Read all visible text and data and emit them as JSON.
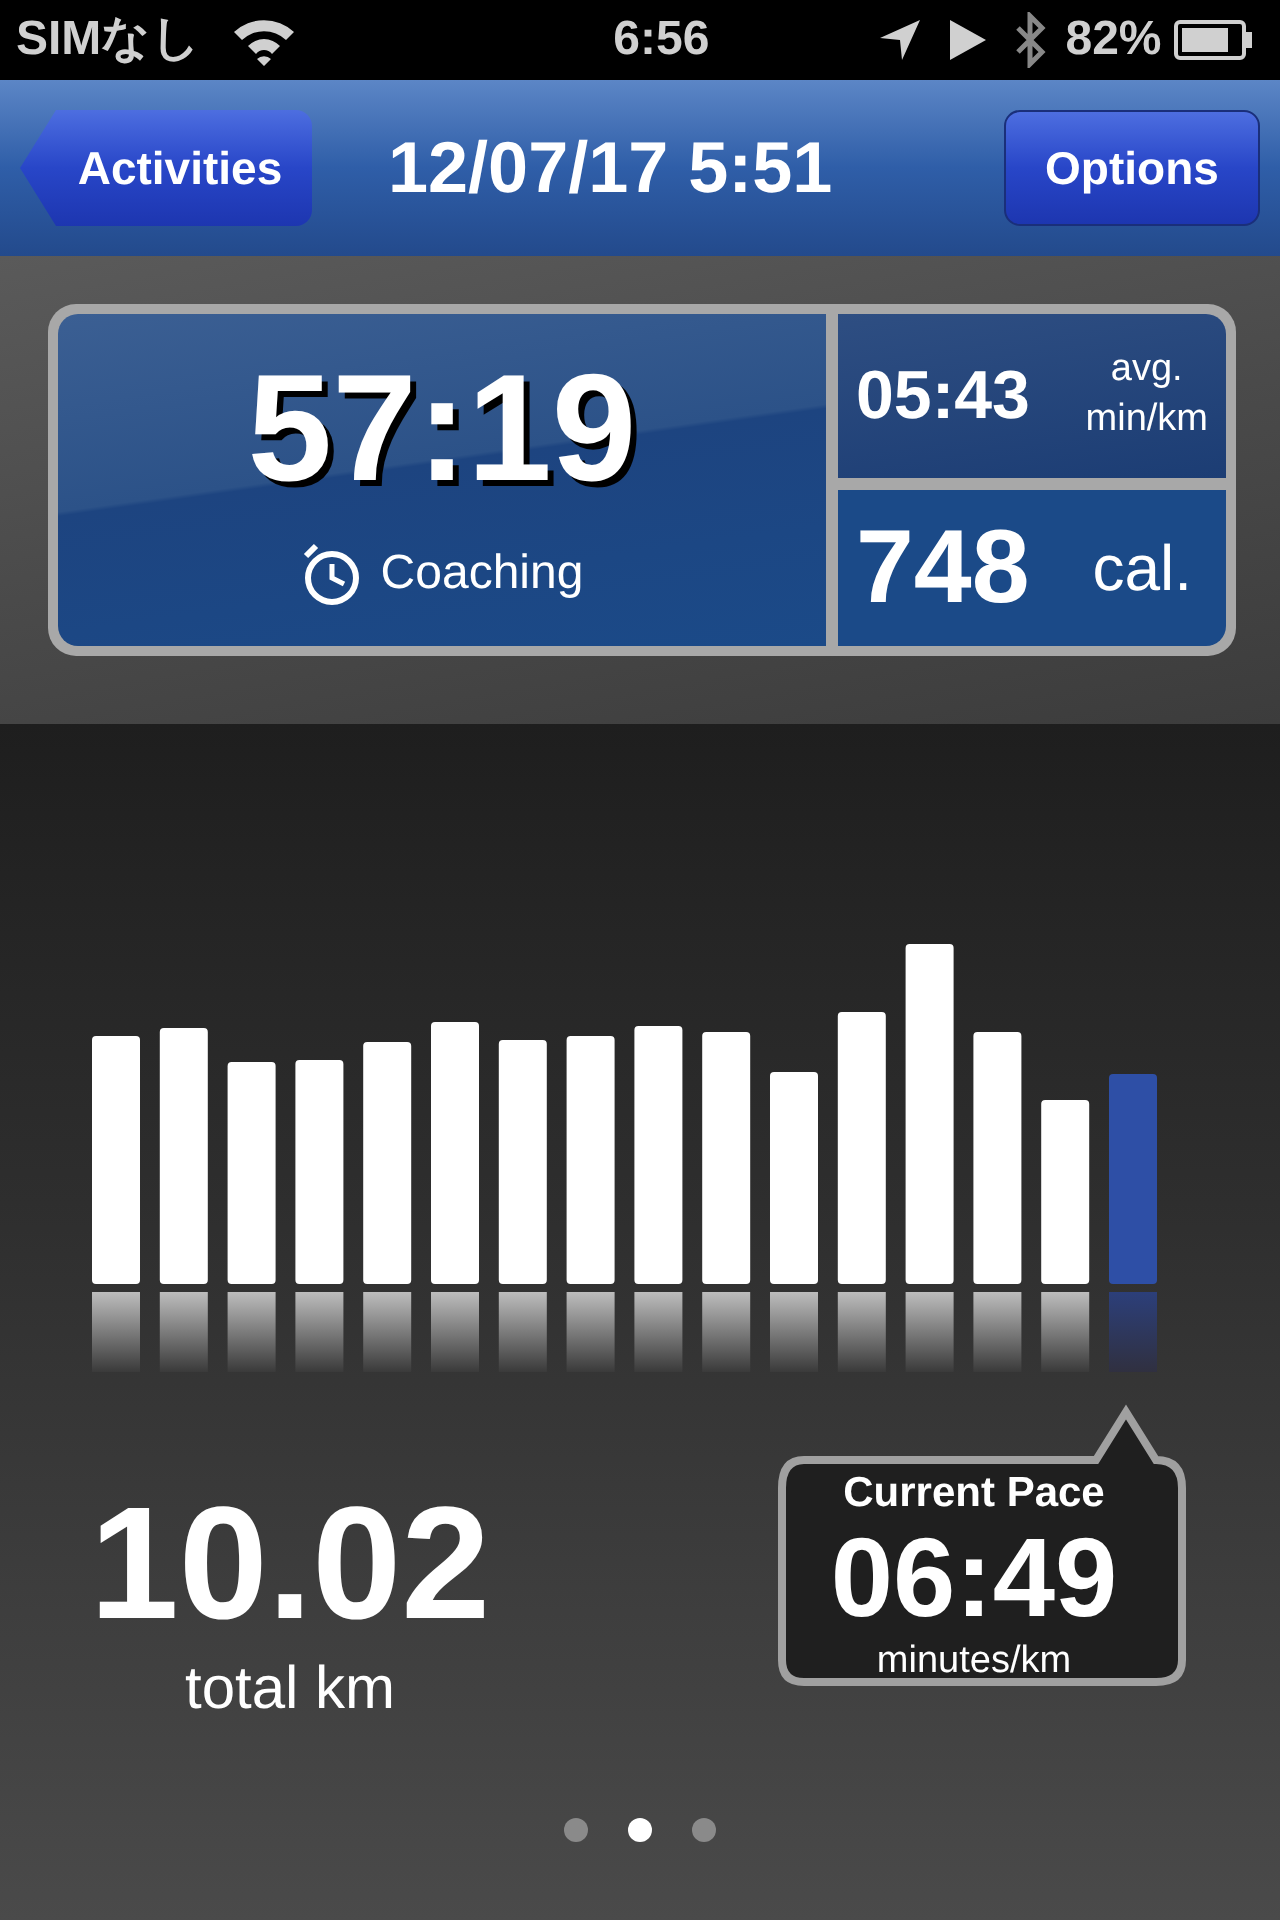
{
  "status_bar": {
    "carrier": "SIMなし",
    "time": "6:56",
    "battery": "82%"
  },
  "nav_bar": {
    "back_button": "Activities",
    "title": "12/07/17 5:51",
    "options_button": "Options"
  },
  "summary": {
    "duration": "57:19",
    "mode": "Coaching",
    "avg_pace": "05:43",
    "avg_label": "avg.",
    "avg_unit": "min/km",
    "calories": "748",
    "calories_unit": "cal."
  },
  "distance": {
    "value": "10.02",
    "unit": "total km"
  },
  "current_pace": {
    "title": "Current Pace",
    "value": "06:49",
    "unit": "minutes/km"
  },
  "pages": [
    {
      "selected": false
    },
    {
      "selected": true
    },
    {
      "selected": false
    }
  ]
}
